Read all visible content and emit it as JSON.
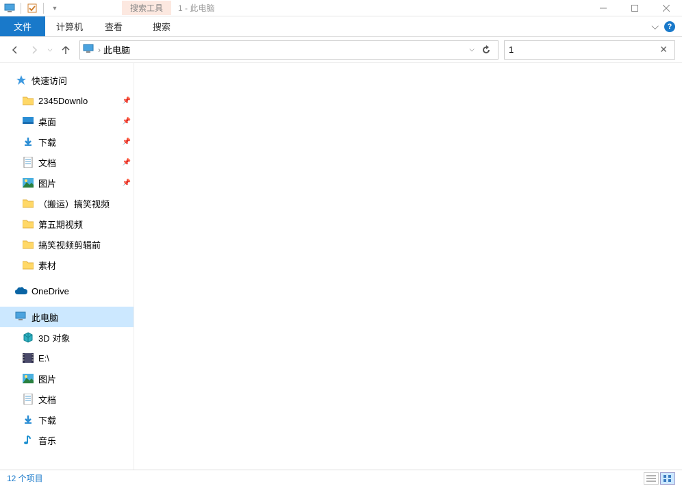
{
  "titlebar": {
    "context_tab": "搜索工具",
    "title": "1 - 此电脑"
  },
  "ribbon": {
    "file": "文件",
    "tabs": [
      "计算机",
      "查看",
      "搜索"
    ]
  },
  "nav": {
    "breadcrumb_sep": "›",
    "location": "此电脑",
    "search_value": "1"
  },
  "sidebar": {
    "quick_access": "快速访问",
    "quick_items": [
      {
        "label": "2345Downlo",
        "icon": "folder",
        "pinned": true
      },
      {
        "label": "桌面",
        "icon": "desktop",
        "pinned": true
      },
      {
        "label": "下载",
        "icon": "download",
        "pinned": true
      },
      {
        "label": "文档",
        "icon": "document",
        "pinned": true
      },
      {
        "label": "图片",
        "icon": "picture",
        "pinned": true
      },
      {
        "label": "（搬运）搞笑视频",
        "icon": "folder",
        "pinned": false
      },
      {
        "label": "第五期视频",
        "icon": "folder",
        "pinned": false
      },
      {
        "label": "搞笑视频剪辑前",
        "icon": "folder",
        "pinned": false
      },
      {
        "label": "素材",
        "icon": "folder",
        "pinned": false
      }
    ],
    "onedrive": "OneDrive",
    "this_pc": "此电脑",
    "pc_items": [
      {
        "label": "3D 对象",
        "icon": "3d"
      },
      {
        "label": "E:\\",
        "icon": "video"
      },
      {
        "label": "图片",
        "icon": "picture"
      },
      {
        "label": "文档",
        "icon": "document"
      },
      {
        "label": "下载",
        "icon": "download"
      },
      {
        "label": "音乐",
        "icon": "music"
      }
    ]
  },
  "statusbar": {
    "item_count": "12 个项目"
  }
}
